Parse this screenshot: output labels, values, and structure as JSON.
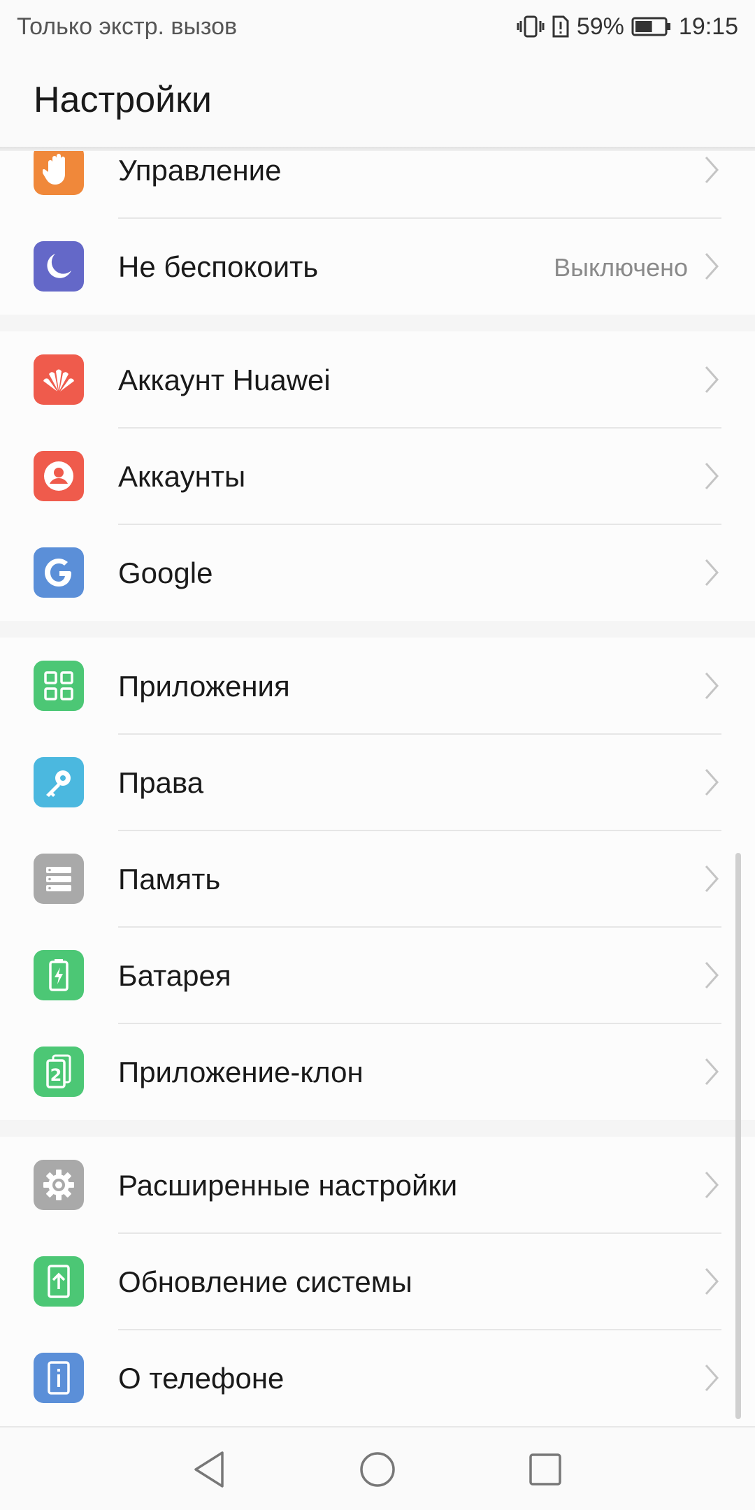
{
  "status_bar": {
    "carrier_text": "Только экстр. вызов",
    "battery_percent": "59%",
    "time": "19:15",
    "battery_level": 0.59,
    "icons": [
      "vibrate-icon",
      "sim-alert-icon",
      "battery-icon"
    ]
  },
  "header": {
    "title": "Настройки"
  },
  "groups": [
    {
      "items": [
        {
          "label": "Управление",
          "icon": "hand-icon",
          "color": "#f0883a"
        },
        {
          "label": "Не беспокоить",
          "value": "Выключено",
          "icon": "moon-icon",
          "color": "#6468c8"
        }
      ]
    },
    {
      "items": [
        {
          "label": "Аккаунт Huawei",
          "icon": "huawei-logo-icon",
          "color": "#ef5b4c"
        },
        {
          "label": "Аккаунты",
          "icon": "person-icon",
          "color": "#ef5b4c"
        },
        {
          "label": "Google",
          "icon": "google-icon",
          "color": "#5b8fd8"
        }
      ]
    },
    {
      "items": [
        {
          "label": "Приложения",
          "icon": "apps-grid-icon",
          "color": "#4cc775"
        },
        {
          "label": "Права",
          "icon": "key-icon",
          "color": "#4bb8df"
        },
        {
          "label": "Память",
          "icon": "storage-icon",
          "color": "#a9a9a9"
        },
        {
          "label": "Батарея",
          "icon": "battery-charging-icon",
          "color": "#4cc775"
        },
        {
          "label": "Приложение-клон",
          "icon": "app-twin-icon",
          "color": "#4cc775"
        }
      ]
    },
    {
      "items": [
        {
          "label": "Расширенные настройки",
          "icon": "gear-icon",
          "color": "#a9a9a9"
        },
        {
          "label": "Обновление системы",
          "icon": "system-update-icon",
          "color": "#4cc775"
        },
        {
          "label": "О телефоне",
          "icon": "info-icon",
          "color": "#5b8fd8"
        }
      ]
    }
  ],
  "nav_bar": {
    "buttons": [
      "back-icon",
      "home-icon",
      "recents-icon"
    ]
  }
}
